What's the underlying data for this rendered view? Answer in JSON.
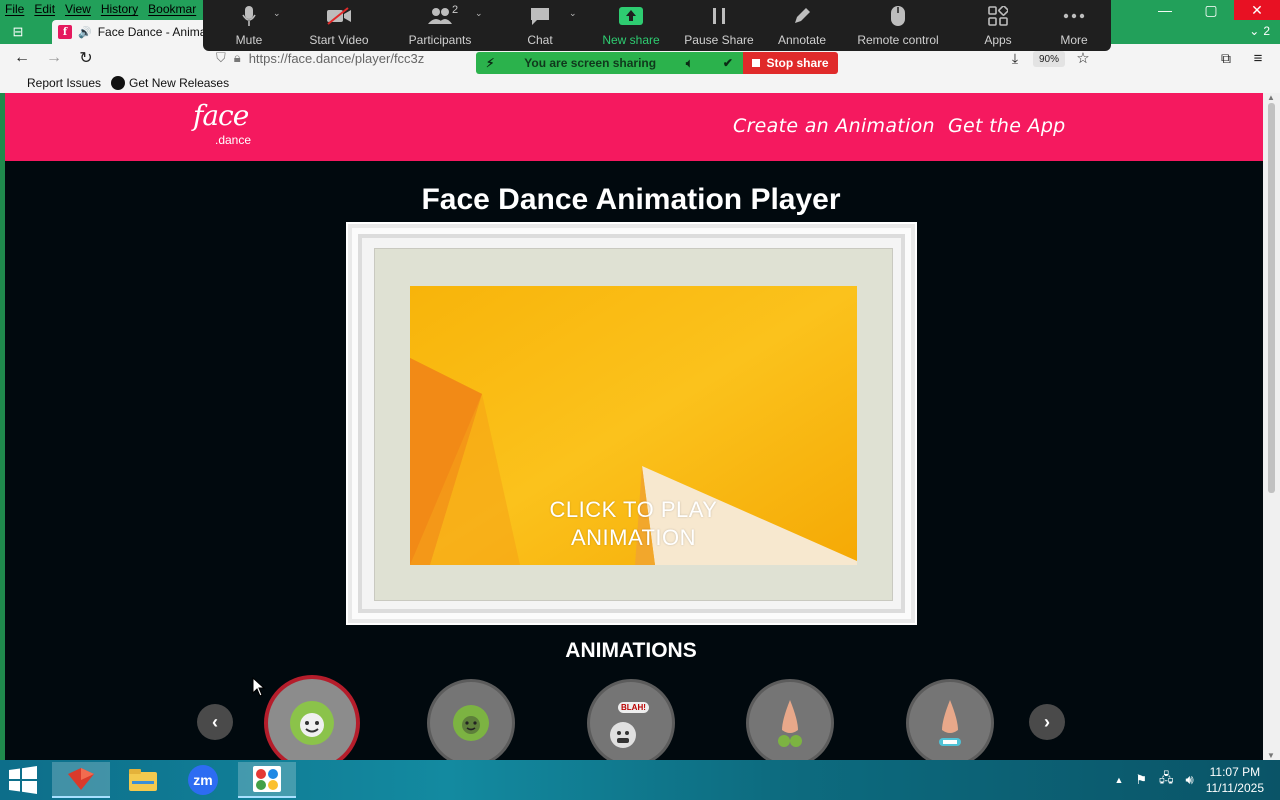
{
  "browser": {
    "menu": [
      "File",
      "Edit",
      "View",
      "History",
      "Bookmar"
    ],
    "tab_title": "Face Dance - Anima",
    "url": "https://face.dance/player/fcc3z",
    "zoom": "90%",
    "tab_count": "2",
    "bookmarks": [
      "Report Issues",
      "Get New Releases"
    ],
    "window_close": "✕"
  },
  "zoom_toolbar": {
    "items": [
      {
        "label": "Mute",
        "icon": "microphone-icon"
      },
      {
        "label": "Start Video",
        "icon": "video-off-icon"
      },
      {
        "label": "Participants",
        "icon": "participants-icon",
        "badge": "2"
      },
      {
        "label": "Chat",
        "icon": "chat-icon"
      },
      {
        "label": "New share",
        "icon": "share-up-icon"
      },
      {
        "label": "Pause Share",
        "icon": "pause-icon"
      },
      {
        "label": "Annotate",
        "icon": "pencil-icon"
      },
      {
        "label": "Remote control",
        "icon": "mouse-icon"
      },
      {
        "label": "Apps",
        "icon": "apps-icon"
      },
      {
        "label": "More",
        "icon": "more-icon"
      }
    ],
    "sharing_message": "You are screen sharing",
    "stop_share": "Stop share"
  },
  "site": {
    "logo_face": "face",
    "logo_dance": ".dance",
    "nav": [
      "Create an Animation",
      "Get the App"
    ],
    "title": "Face Dance Animation Player",
    "play_overlay_line1": "CLICK TO PLAY",
    "play_overlay_line2": "ANIMATION",
    "animations_heading": "ANIMATIONS",
    "thumb_badge": "BLAH!"
  },
  "taskbar": {
    "time": "11:07 PM",
    "date": "11/11/2025",
    "apps": [
      "explorer-app",
      "file-manager-app",
      "zoom-app",
      "paint-app"
    ],
    "zoom_label": "zm"
  },
  "colors": {
    "site_pink": "#f5195f",
    "zoom_green": "#2bb24c",
    "stop_red": "#e02a2a",
    "page_bg": "#01090e"
  }
}
